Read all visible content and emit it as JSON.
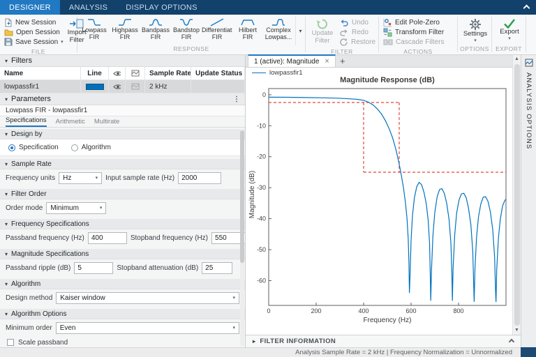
{
  "toolstrip": {
    "tabs": [
      {
        "label": "DESIGNER"
      },
      {
        "label": "ANALYSIS"
      },
      {
        "label": "DISPLAY OPTIONS"
      }
    ],
    "file": {
      "section": "FILE",
      "new": "New Session",
      "open": "Open Session",
      "save": "Save Session",
      "import_line1": "Import",
      "import_line2": "Filter"
    },
    "response": {
      "section": "RESPONSE",
      "items": [
        {
          "line1": "Lowpass",
          "line2": "FIR"
        },
        {
          "line1": "Highpass",
          "line2": "FIR"
        },
        {
          "line1": "Bandpass",
          "line2": "FIR"
        },
        {
          "line1": "Bandstop",
          "line2": "FIR"
        },
        {
          "line1": "Differentiati",
          "line2": "FIR"
        },
        {
          "line1": "Hilbert",
          "line2": "FIR"
        },
        {
          "line1": "Complex",
          "line2": "Lowpas..."
        }
      ]
    },
    "filter": {
      "section": "FILTER",
      "update_line1": "Update",
      "update_line2": "Filter",
      "undo": "Undo",
      "redo": "Redo",
      "restore": "Restore"
    },
    "actions": {
      "section": "ACTIONS",
      "edit_pz": "Edit Pole-Zero",
      "transform": "Transform Filter",
      "cascade": "Cascade Filters"
    },
    "options": {
      "section": "OPTIONS",
      "settings": "Settings"
    },
    "exports": {
      "section": "EXPORT",
      "label": "Export"
    }
  },
  "filters_panel": {
    "title": "Filters",
    "columns": {
      "name": "Name",
      "line": "Line",
      "sample_rate": "Sample Rate",
      "update_status": "Update Status"
    },
    "rows": [
      {
        "name": "lowpassfir1",
        "line_color": "#0072BD",
        "sample_rate": "2 kHz",
        "update_status": ""
      }
    ]
  },
  "parameters_panel": {
    "title": "Parameters",
    "subtitle": "Lowpass FIR - lowpassfir1",
    "tabs": [
      {
        "label": "Specifications"
      },
      {
        "label": "Arithmetic"
      },
      {
        "label": "Multirate"
      }
    ],
    "design_by": {
      "section": "Design by",
      "options": [
        {
          "label": "Specification",
          "selected": true
        },
        {
          "label": "Algorithm",
          "selected": false
        }
      ]
    },
    "sample_rate": {
      "section": "Sample Rate",
      "freq_units_label": "Frequency units",
      "freq_units_value": "Hz",
      "input_rate_label": "Input sample rate (Hz)",
      "input_rate_value": "2000"
    },
    "filter_order": {
      "section": "Filter Order",
      "order_mode_label": "Order mode",
      "order_mode_value": "Minimum"
    },
    "frequency_specs": {
      "section": "Frequency Specifications",
      "passband_label": "Passband frequency (Hz)",
      "passband_value": "400",
      "stopband_label": "Stopband frequency (Hz)",
      "stopband_value": "550"
    },
    "magnitude_specs": {
      "section": "Magnitude Specifications",
      "ripple_label": "Passband ripple (dB)",
      "ripple_value": "5",
      "atten_label": "Stopband attenuation (dB)",
      "atten_value": "25"
    },
    "algorithm": {
      "section": "Algorithm",
      "method_label": "Design method",
      "method_value": "Kaiser window"
    },
    "algorithm_options": {
      "section": "Algorithm Options",
      "min_order_label": "Minimum order",
      "min_order_value": "Even",
      "scale_label": "Scale passband",
      "scale_checked": false
    }
  },
  "document_area": {
    "tab_label": "1 (active): Magnitude",
    "close_label": "×",
    "add_label": "+",
    "filter_info": "FILTER INFORMATION"
  },
  "right_strip": {
    "label": "ANALYSIS OPTIONS"
  },
  "status_bar": {
    "text": "Analysis Sample Rate = 2 kHz | Frequency Normalization = Unnormalized"
  },
  "chart_data": {
    "type": "line",
    "title": "Magnitude Response (dB)",
    "xlabel": "Frequency (Hz)",
    "ylabel": "Magnitude (dB)",
    "xlim": [
      0,
      1000
    ],
    "ylim": [
      -68,
      2
    ],
    "xticks": [
      0,
      200,
      400,
      600,
      800
    ],
    "yticks": [
      0,
      -10,
      -20,
      -30,
      -40,
      -50,
      -60
    ],
    "grid": false,
    "legend_position": "top-left",
    "series": [
      {
        "name": "lowpassfir1",
        "color": "#0072BD",
        "points": [
          [
            0,
            -0.8
          ],
          [
            80,
            -0.82
          ],
          [
            160,
            -0.9
          ],
          [
            230,
            -1.0
          ],
          [
            290,
            -1.1
          ],
          [
            340,
            -1.3
          ],
          [
            375,
            -1.5
          ],
          [
            400,
            -1.8
          ],
          [
            420,
            -2.4
          ],
          [
            440,
            -3.3
          ],
          [
            458,
            -4.6
          ],
          [
            475,
            -6.2
          ],
          [
            492,
            -8.4
          ],
          [
            508,
            -11.0
          ],
          [
            522,
            -13.9
          ],
          [
            536,
            -17.6
          ],
          [
            548,
            -21.6
          ],
          [
            558,
            -25.6
          ],
          [
            568,
            -30.0
          ],
          [
            576,
            -34.6
          ],
          [
            583,
            -40.0
          ],
          [
            588,
            -46.5
          ],
          [
            591,
            -54.0
          ],
          [
            593,
            -64.0
          ],
          [
            596,
            -58.0
          ],
          [
            600,
            -47.0
          ],
          [
            606,
            -39.0
          ],
          [
            614,
            -33.2
          ],
          [
            624,
            -29.6
          ],
          [
            634,
            -28.3
          ],
          [
            644,
            -29.0
          ],
          [
            654,
            -31.4
          ],
          [
            664,
            -35.2
          ],
          [
            672,
            -40.5
          ],
          [
            678,
            -48.0
          ],
          [
            681,
            -58.0
          ],
          [
            683,
            -66.5
          ],
          [
            686,
            -57.0
          ],
          [
            692,
            -45.5
          ],
          [
            700,
            -38.0
          ],
          [
            710,
            -32.9
          ],
          [
            720,
            -30.6
          ],
          [
            730,
            -30.3
          ],
          [
            740,
            -31.8
          ],
          [
            750,
            -35.0
          ],
          [
            760,
            -40.2
          ],
          [
            768,
            -48.0
          ],
          [
            772,
            -58.0
          ],
          [
            774,
            -66.5
          ],
          [
            777,
            -56.0
          ],
          [
            784,
            -45.0
          ],
          [
            792,
            -38.2
          ],
          [
            802,
            -34.0
          ],
          [
            812,
            -32.0
          ],
          [
            822,
            -31.8
          ],
          [
            832,
            -33.2
          ],
          [
            842,
            -36.6
          ],
          [
            852,
            -42.0
          ],
          [
            860,
            -50.5
          ],
          [
            864,
            -62.0
          ],
          [
            866,
            -66.8
          ],
          [
            869,
            -56.5
          ],
          [
            876,
            -46.0
          ],
          [
            884,
            -39.4
          ],
          [
            894,
            -35.2
          ],
          [
            904,
            -33.1
          ],
          [
            914,
            -32.9
          ],
          [
            924,
            -34.4
          ],
          [
            934,
            -37.8
          ],
          [
            944,
            -43.5
          ],
          [
            952,
            -52.5
          ],
          [
            956,
            -63.0
          ],
          [
            958,
            -66.9
          ],
          [
            961,
            -56.5
          ],
          [
            968,
            -46.5
          ],
          [
            976,
            -40.2
          ],
          [
            986,
            -35.8
          ],
          [
            996,
            -34.0
          ],
          [
            1000,
            -33.8
          ]
        ]
      }
    ],
    "mask_color": "#e8453c",
    "mask_style": "dashed",
    "mask_segments": [
      [
        [
          0,
          -2.5
        ],
        [
          550,
          -2.5
        ]
      ],
      [
        [
          400,
          -2.5
        ],
        [
          400,
          -25
        ]
      ],
      [
        [
          550,
          -2.5
        ],
        [
          550,
          -25
        ]
      ],
      [
        [
          400,
          -25
        ],
        [
          1000,
          -25
        ]
      ]
    ]
  }
}
